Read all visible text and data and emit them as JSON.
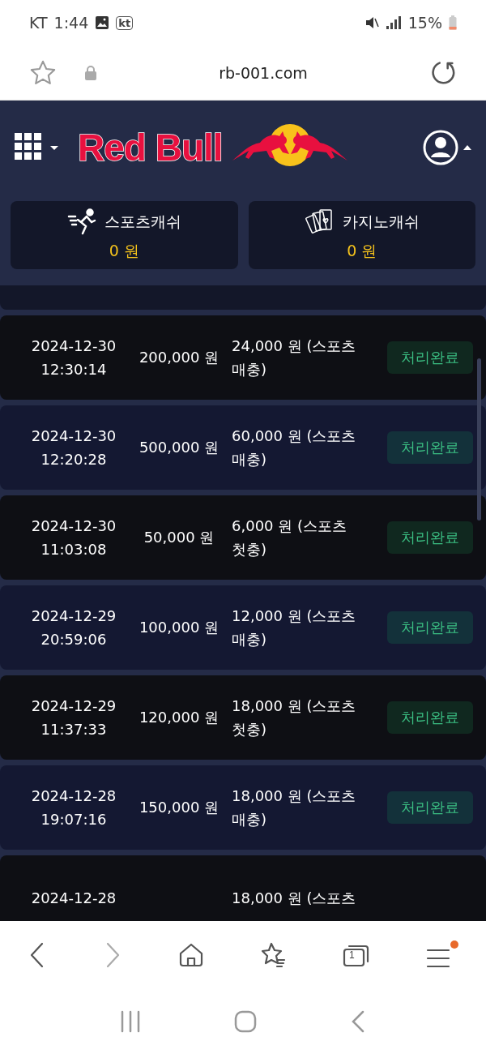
{
  "status_bar": {
    "carrier": "KT",
    "time": "1:44",
    "carrier_badge": "kt",
    "battery": "15%"
  },
  "address_bar": {
    "url": "rb-001.com"
  },
  "header": {
    "logo": "Red Bull"
  },
  "wallets": [
    {
      "kind": "sports",
      "label": "스포츠캐쉬",
      "amount": "0 원"
    },
    {
      "kind": "casino",
      "label": "카지노캐쉬",
      "amount": "0 원"
    }
  ],
  "rows": [
    {
      "date": "2024-12-30",
      "time": "12:30:14",
      "amount": "200,000 원",
      "bonus": "24,000 원 (스포츠 매충)",
      "status": "처리완료"
    },
    {
      "date": "2024-12-30",
      "time": "12:20:28",
      "amount": "500,000 원",
      "bonus": "60,000 원 (스포츠 매충)",
      "status": "처리완료"
    },
    {
      "date": "2024-12-30",
      "time": "11:03:08",
      "amount": "50,000 원",
      "bonus": "6,000 원 (스포츠 첫충)",
      "status": "처리완료"
    },
    {
      "date": "2024-12-29",
      "time": "20:59:06",
      "amount": "100,000 원",
      "bonus": "12,000 원 (스포츠 매충)",
      "status": "처리완료"
    },
    {
      "date": "2024-12-29",
      "time": "11:37:33",
      "amount": "120,000 원",
      "bonus": "18,000 원 (스포츠 첫충)",
      "status": "처리완료"
    },
    {
      "date": "2024-12-28",
      "time": "19:07:16",
      "amount": "150,000 원",
      "bonus": "18,000 원 (스포츠 매충)",
      "status": "처리완료"
    },
    {
      "date": "2024-12-28",
      "bonus": "18,000 원 (스포츠"
    }
  ],
  "browser_toolbar": {
    "tab_count": "1",
    "menu_badge": true
  }
}
